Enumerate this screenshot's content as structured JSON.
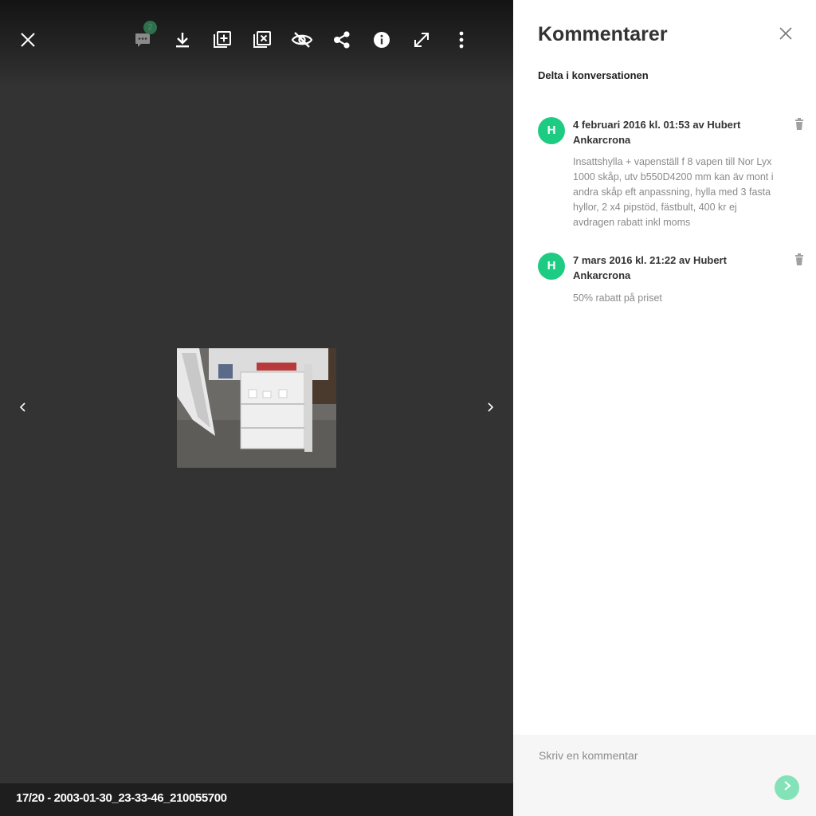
{
  "viewer": {
    "toolbar": {
      "comment_count": "2",
      "icons": [
        "close-icon",
        "comment-icon",
        "download-icon",
        "add-to-album-icon",
        "remove-from-album-icon",
        "hide-icon",
        "share-icon",
        "info-icon",
        "fullscreen-icon",
        "more-icon"
      ]
    },
    "caption": "17/20 - 2003-01-30_23-33-46_210055700"
  },
  "comments_panel": {
    "title": "Kommentarer",
    "subtitle": "Delta i konversationen",
    "comments": [
      {
        "avatar_initial": "H",
        "header": "4 februari 2016 kl. 01:53 av Hubert Ankarcrona",
        "body": "Insattshylla + vapenställ f 8 vapen till Nor Lyx 1000 skåp, utv b550D4200 mm kan äv mont i andra skåp eft anpassning, hylla med 3 fasta hyllor, 2 x4 pipstöd, fästbult, 400 kr ej avdragen rabatt inkl moms"
      },
      {
        "avatar_initial": "H",
        "header": "7 mars 2016 kl. 21:22 av Hubert Ankarcrona",
        "body": "50% rabatt på priset"
      }
    ],
    "composer": {
      "placeholder": "Skriv en kommentar"
    }
  },
  "colors": {
    "accent": "#1ecb83",
    "send": "#83e2b8",
    "viewer_bg": "#333333",
    "panel_bg": "#ffffff"
  }
}
